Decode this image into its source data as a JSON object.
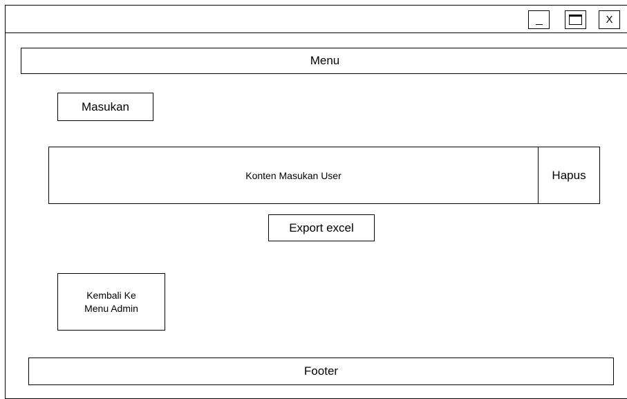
{
  "window": {
    "minimize_label": "_",
    "close_label": "X"
  },
  "menu": {
    "label": "Menu"
  },
  "main": {
    "masukan_label": "Masukan",
    "content_label": "Konten Masukan User",
    "delete_label": "Hapus",
    "export_label": "Export excel",
    "back_label": "Kembali Ke Menu Admin"
  },
  "footer": {
    "label": "Footer"
  }
}
